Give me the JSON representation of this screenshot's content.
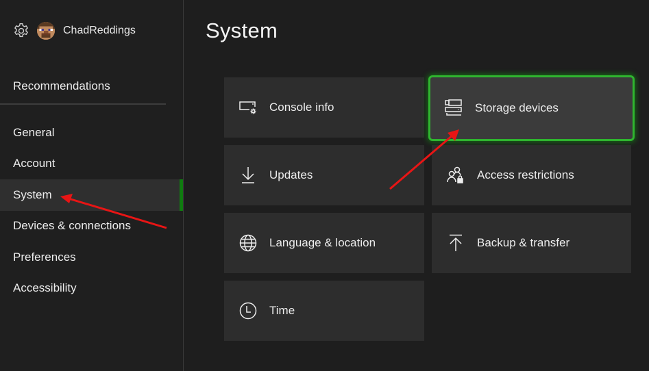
{
  "profile": {
    "settings_icon": "gear-icon",
    "avatar": "avatar",
    "username": "ChadReddings"
  },
  "sidebar": {
    "recommendations": "Recommendations",
    "items": [
      {
        "label": "General",
        "active": false
      },
      {
        "label": "Account",
        "active": false
      },
      {
        "label": "System",
        "active": true
      },
      {
        "label": "Devices & connections",
        "active": false
      },
      {
        "label": "Preferences",
        "active": false
      },
      {
        "label": "Accessibility",
        "active": false
      }
    ]
  },
  "main": {
    "title": "System",
    "tiles": [
      {
        "label": "Console info",
        "icon": "console-info-icon"
      },
      {
        "label": "Storage devices",
        "icon": "storage-devices-icon",
        "focused": true
      },
      {
        "label": "Updates",
        "icon": "download-icon"
      },
      {
        "label": "Access restrictions",
        "icon": "access-restrictions-icon"
      },
      {
        "label": "Language & location",
        "icon": "globe-icon"
      },
      {
        "label": "Backup & transfer",
        "icon": "upload-icon"
      },
      {
        "label": "Time",
        "icon": "clock-icon"
      }
    ]
  },
  "colors": {
    "accent_green": "#107c10",
    "focus_border": "#2fb52f",
    "annotation_arrow": "#e81515"
  }
}
